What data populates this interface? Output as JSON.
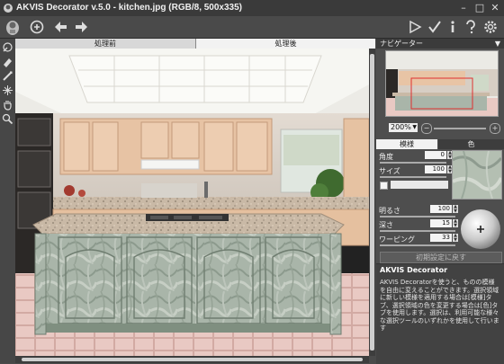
{
  "window": {
    "title": "AKVIS Decorator v.5.0 - kitchen.jpg (RGB/8, 500x335)",
    "minimize": "–",
    "maximize": "□",
    "close": "✕"
  },
  "toolbar": {
    "icons": [
      "akvis-logo-icon",
      "undo-icon",
      "back-arrow-icon",
      "forward-arrow-icon",
      "run-icon",
      "apply-icon",
      "info-icon",
      "help-icon",
      "settings-icon"
    ]
  },
  "left_tools": [
    "selection-brush-icon",
    "eraser-icon",
    "stroke-tool-icon",
    "magic-tool-icon",
    "hand-icon",
    "zoom-icon"
  ],
  "view_tabs": {
    "before": "処理前",
    "after": "処理後"
  },
  "navigator": {
    "header": "ナビゲーター",
    "zoom": "200%"
  },
  "settings": {
    "tabs": {
      "pattern": "模様",
      "color": "色"
    },
    "angle_label": "角度",
    "angle_value": "0",
    "size_label": "サイズ",
    "size_value": "100",
    "brightness_label": "明るさ",
    "brightness_value": "100",
    "depth_label": "深さ",
    "depth_value": "15",
    "warping_label": "ワーピング",
    "warping_value": "33",
    "reset_label": "初期設定に戻す"
  },
  "help": {
    "title": "AKVIS Decorator",
    "text": "AKVIS Decoratorを使うと、ものの模様を自由に変えることができます。選択領域に新しい模様を適用する場合は[模様]タブ、選択領域の色を変更する場合は[色]タブを使用します。選択は、利用可能な様々な選択ツールのいずれかを使用して行います"
  },
  "colors": {
    "accent": "#f0f0f0",
    "panel_bg": "#4e4e4e",
    "dark_bg": "#3b3b3b"
  }
}
